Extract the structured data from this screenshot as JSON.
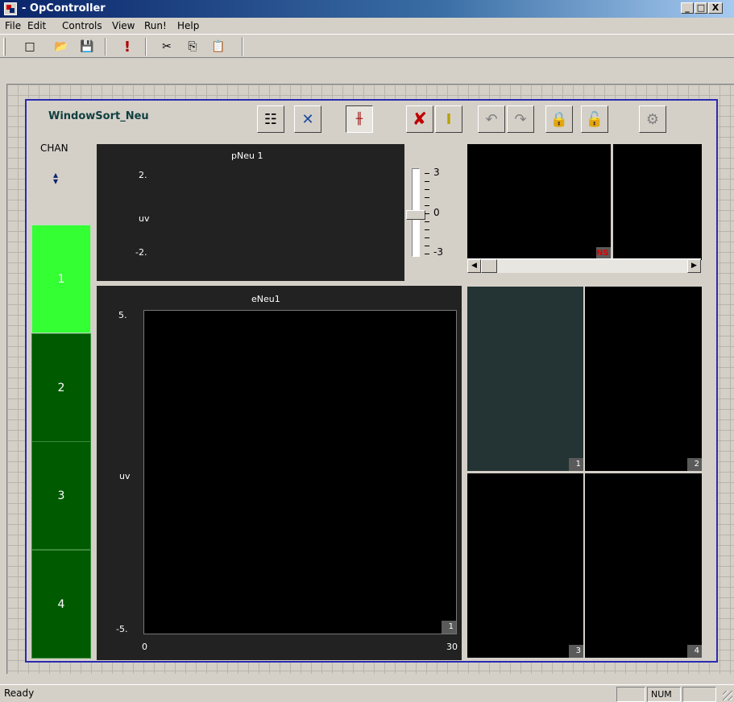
{
  "window": {
    "title": "- OpController",
    "minimize": "_",
    "maximize": "□",
    "close": "X"
  },
  "menu": [
    "File",
    "Edit",
    "Controls",
    "View",
    "Run!",
    "Help"
  ],
  "toolbar": {
    "new": "□",
    "open": "📂",
    "save": "💾",
    "run": "!",
    "cut": "✂",
    "copy": "⎘",
    "paste": "📋"
  },
  "panel": {
    "title": "WindowSort_Neu",
    "buttons": {
      "properties": "☷",
      "transform": "✕",
      "waveform": "╫",
      "delete": "✘",
      "insert": "I",
      "undo": "↶",
      "redo": "↷",
      "lock": "🔒",
      "unlock": "🔓",
      "options": "⚙"
    }
  },
  "channels": {
    "label": "CHAN",
    "spinner": "▲▼",
    "items": [
      "1",
      "2",
      "3",
      "4"
    ],
    "selected": "1"
  },
  "pneu": {
    "title": "pNeu 1",
    "ytop": "2.",
    "unit": "uv",
    "ybottom": "-2."
  },
  "slider": {
    "ticks": [
      "3",
      "0",
      "-3"
    ],
    "value": 0
  },
  "overview": {
    "badge": "NS"
  },
  "eneu": {
    "title": "eNeu1",
    "ytop": "5.",
    "unit": "uv",
    "ybottom": "-5.",
    "xmin": "0",
    "xmax": "30",
    "corner": "1"
  },
  "units": {
    "labels": [
      "1",
      "2",
      "3",
      "4"
    ]
  },
  "status": {
    "text": "Ready",
    "num": "NUM"
  },
  "colors": {
    "chan_selected": "#33ff33",
    "chan_other": "#005a00",
    "scope_bg": "#222222",
    "unit_highlight": "#243333"
  }
}
